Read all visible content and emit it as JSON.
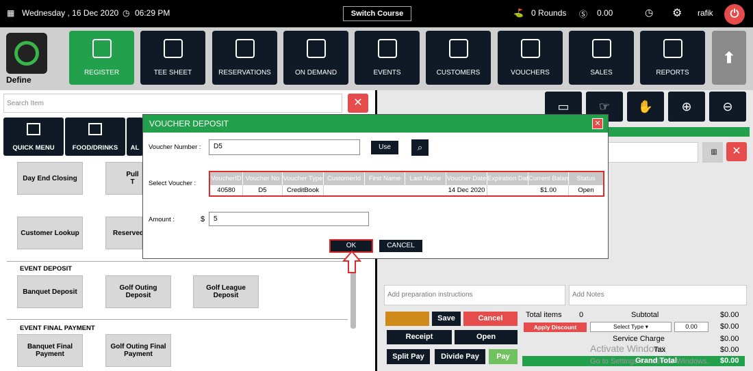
{
  "topbar": {
    "date": "Wednesday , 16 Dec 2020",
    "time": "06:29 PM",
    "switch_course": "Switch Course",
    "rounds": "0 Rounds",
    "amount": "0.00",
    "user": "rafik"
  },
  "logo": {
    "label": "Define"
  },
  "nav": [
    {
      "label": "REGISTER",
      "icon": "barcode-scanner-icon"
    },
    {
      "label": "TEE SHEET",
      "icon": "tee-sheet-icon"
    },
    {
      "label": "RESERVATIONS",
      "icon": "calendar-icon"
    },
    {
      "label": "ON DEMAND",
      "icon": "mobile-icon"
    },
    {
      "label": "EVENTS",
      "icon": "events-calendar-icon"
    },
    {
      "label": "CUSTOMERS",
      "icon": "customers-icon"
    },
    {
      "label": "VOUCHERS",
      "icon": "voucher-icon"
    },
    {
      "label": "SALES",
      "icon": "sales-icon"
    },
    {
      "label": "REPORTS",
      "icon": "reports-icon"
    }
  ],
  "left": {
    "search_placeholder": "Search Item",
    "categories": [
      {
        "label": "QUICK MENU"
      },
      {
        "label": "FOOD/DRINKS"
      },
      {
        "label": "AL"
      }
    ],
    "tiles": {
      "day_end": "Day End Closing",
      "pull": "Pull T",
      "customer_lookup": "Customer Lookup",
      "reserved": "Reserved"
    },
    "event_deposit": {
      "title": "EVENT DEPOSIT",
      "items": [
        "Banquet Deposit",
        "Golf Outing Deposit",
        "Golf League Deposit"
      ]
    },
    "event_final": {
      "title": "EVENT FINAL PAYMENT",
      "items": [
        "Banquet Final Payment",
        "Golf Outing Final Payment"
      ]
    }
  },
  "right": {
    "prep_placeholder": "Add preparation instructions",
    "notes_placeholder": "Add Notes",
    "save": "Save",
    "cancel": "Cancel",
    "receipt": "Receipt",
    "open": "Open",
    "split_pay": "Split Pay",
    "divide_pay": "Divide Pay",
    "pay": "Pay",
    "total_items_label": "Total items",
    "total_items_value": "0",
    "subtotal_label": "Subtotal",
    "subtotal_value": "$0.00",
    "apply_discount": "Apply Discount",
    "select_type": "Select Type",
    "discount_input": "0.00",
    "discount_value": "$0.00",
    "service_charge_label": "Service Charge",
    "service_charge_value": "$0.00",
    "tax_label": "Tax",
    "tax_value": "$0.00",
    "grand_total_label": "Grand Total",
    "grand_total_value": "$0.00",
    "watermark1": "Activate Windows",
    "watermark2": "Go to Settings to activate Windows."
  },
  "dialog": {
    "title": "VOUCHER DEPOSIT",
    "voucher_number_label": "Voucher Number :",
    "voucher_number_value": "D5",
    "use": "Use",
    "select_voucher_label": "Select Voucher :",
    "columns": [
      "VoucherID",
      "Voucher No",
      "Voucher Type",
      "CustomerId",
      "First Name",
      "Last Name",
      "Voucher Date",
      "Expiration Dat",
      "Current Balan",
      "Status"
    ],
    "row": [
      "40580",
      "D5",
      "CreditBook",
      "",
      "",
      "",
      "14 Dec 2020",
      "",
      "$1.00",
      "Open"
    ],
    "amount_label": "Amount :",
    "currency": "$",
    "amount_value": "5",
    "ok": "OK",
    "cancel": "CANCEL"
  },
  "colors": {
    "accent_green": "#23a04c",
    "danger_red": "#e74c4c",
    "dark": "#0f1a26",
    "highlight_red": "#e02a2a"
  }
}
